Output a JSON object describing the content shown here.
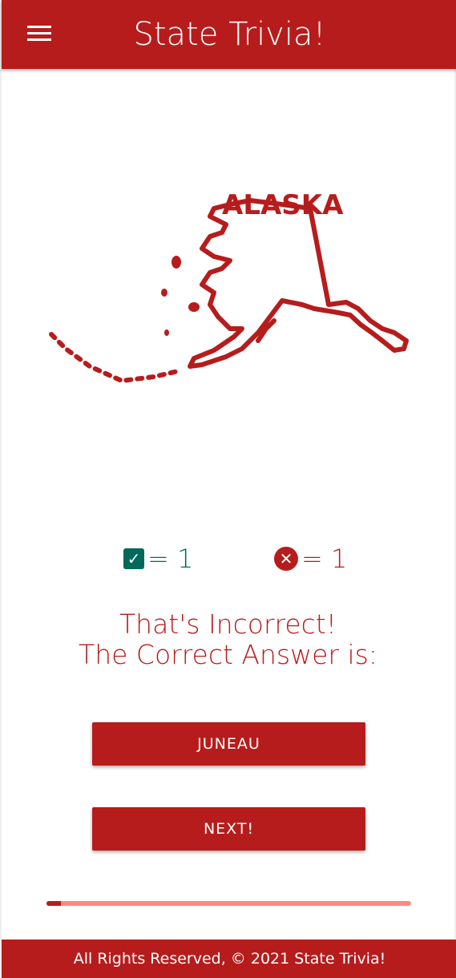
{
  "header": {
    "title": "State Trivia!",
    "menu_icon": "hamburger-icon"
  },
  "map": {
    "label": "ALASKA",
    "color": "#b71c1c"
  },
  "score": {
    "correct_symbol": "= 1",
    "incorrect_symbol": "= 1",
    "correct": 1,
    "incorrect": 1,
    "correct_color": "#00695c",
    "incorrect_color": "#b71c1c"
  },
  "message": {
    "line1": "That's Incorrect!",
    "line2": "The Correct Answer is:"
  },
  "answer_button": "JUNEAU",
  "next_button": "NEXT!",
  "progress": {
    "percent": 4
  },
  "footer": "All Rights Reserved, © 2021 State Trivia!"
}
